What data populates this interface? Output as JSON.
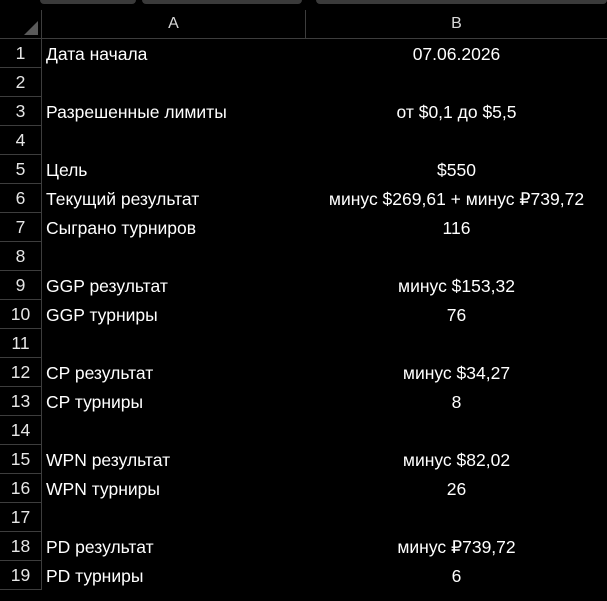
{
  "columns": [
    "A",
    "B"
  ],
  "rows": [
    {
      "n": "1",
      "a": "Дата начала",
      "b": "07.06.2026"
    },
    {
      "n": "2",
      "a": "",
      "b": ""
    },
    {
      "n": "3",
      "a": "Разрешенные лимиты",
      "b": "от $0,1 до $5,5"
    },
    {
      "n": "4",
      "a": "",
      "b": ""
    },
    {
      "n": "5",
      "a": "Цель",
      "b": "$550"
    },
    {
      "n": "6",
      "a": "Текущий результат",
      "b": "минус $269,61 + минус ₽739,72"
    },
    {
      "n": "7",
      "a": "Сыграно турниров",
      "b": "116"
    },
    {
      "n": "8",
      "a": "",
      "b": ""
    },
    {
      "n": "9",
      "a": "GGP результат",
      "b": "минус $153,32"
    },
    {
      "n": "10",
      "a": "GGP турниры",
      "b": "76"
    },
    {
      "n": "11",
      "a": "",
      "b": ""
    },
    {
      "n": "12",
      "a": "CP результат",
      "b": "минус $34,27"
    },
    {
      "n": "13",
      "a": "CP турниры",
      "b": "8"
    },
    {
      "n": "14",
      "a": "",
      "b": ""
    },
    {
      "n": "15",
      "a": "WPN результат",
      "b": "минус $82,02"
    },
    {
      "n": "16",
      "a": "WPN турниры",
      "b": "26"
    },
    {
      "n": "17",
      "a": "",
      "b": ""
    },
    {
      "n": "18",
      "a": "PD результат",
      "b": "минус ₽739,72"
    },
    {
      "n": "19",
      "a": "PD турниры",
      "b": "6"
    }
  ]
}
